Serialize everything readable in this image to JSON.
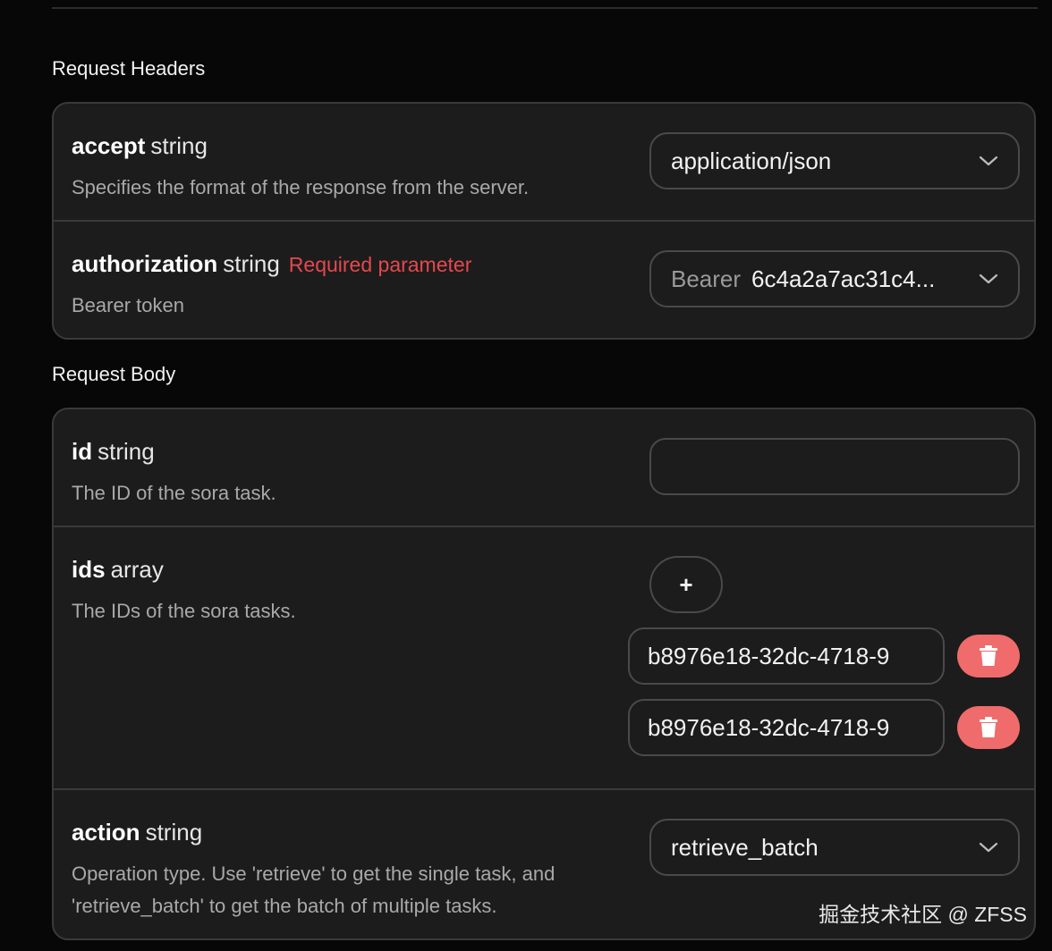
{
  "request_headers": {
    "title": "Request Headers",
    "params": [
      {
        "name": "accept",
        "type": "string",
        "description": "Specifies the format of the response from the server.",
        "value": "application/json"
      },
      {
        "name": "authorization",
        "type": "string",
        "required_label": "Required parameter",
        "description": "Bearer token",
        "prefix": "Bearer",
        "value": "6c4a2a7ac31c4..."
      }
    ]
  },
  "request_body": {
    "title": "Request Body",
    "id": {
      "name": "id",
      "type": "string",
      "description": "The ID of the sora task.",
      "value": ""
    },
    "ids": {
      "name": "ids",
      "type": "array",
      "description": "The IDs of the sora tasks.",
      "add_label": "+",
      "items": [
        "b8976e18-32dc-4718-9",
        "b8976e18-32dc-4718-9"
      ]
    },
    "action": {
      "name": "action",
      "type": "string",
      "description_line1": "Operation type. Use 'retrieve' to get the single task, and",
      "description_line2": "'retrieve_batch' to get the batch of multiple tasks.",
      "value": "retrieve_batch"
    }
  },
  "watermark": "掘金技术社区 @ ZFSS",
  "colors": {
    "background": "#070707",
    "panel": "#1c1c1c",
    "border": "#3a3a3a",
    "required": "#e5484d",
    "delete_button": "#f06b6b"
  }
}
